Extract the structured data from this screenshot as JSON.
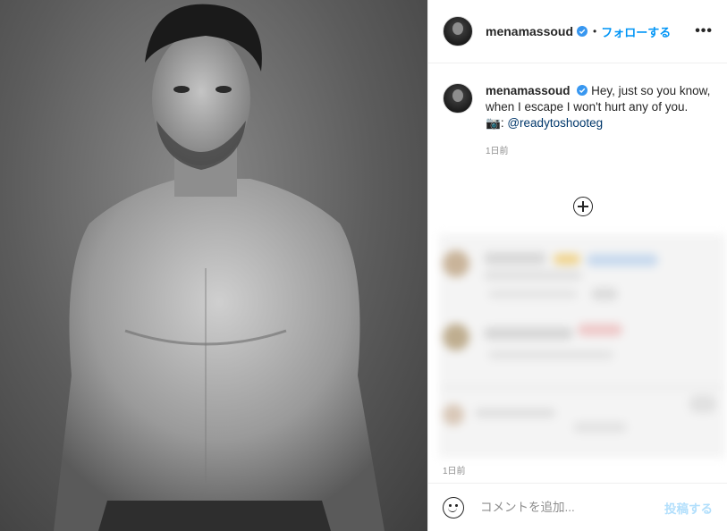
{
  "header": {
    "username": "menamassoud",
    "separator": "•",
    "follow_label": "フォローする",
    "more_label": "•••"
  },
  "caption": {
    "username": "menamassoud",
    "text": "Hey, just so you know, when I escape I won't hurt any of you.",
    "credit_emoji": "📷",
    "credit_sep": ":",
    "mention": "@readytoshooteg",
    "time": "1日前"
  },
  "footer": {
    "time": "1日前",
    "comment_placeholder": "コメントを追加...",
    "post_label": "投稿する"
  },
  "icons": {
    "verified": "verified-badge-icon",
    "more": "more-options-icon",
    "load_more": "plus-circle-icon",
    "emoji": "smiley-face-icon"
  },
  "colors": {
    "link_blue": "#0095f6",
    "mention_blue": "#00376b",
    "post_disabled": "#b2dffc",
    "muted": "#8e8e8e"
  }
}
